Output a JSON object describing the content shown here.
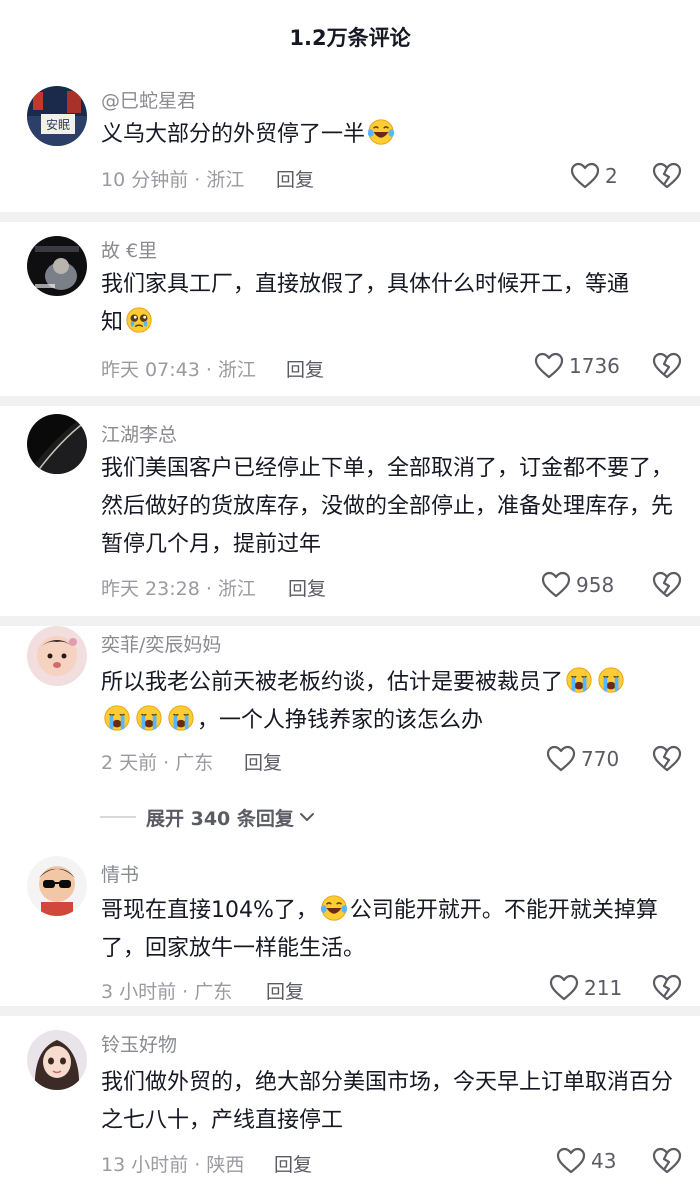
{
  "header": {
    "title": "1.2万条评论"
  },
  "comments": [
    {
      "author": "@巳蛇星君",
      "text": "义乌大部分的外贸停了一半",
      "time": "10 分钟前 · 浙江",
      "reply": "回复",
      "likes": "2",
      "avatar_text": "安眠"
    },
    {
      "author": "故 €里",
      "text_a": "我们家具工厂，直接放假了，具体什么时候开工，等通",
      "text_b": "知",
      "time": "昨天 07:43 · 浙江",
      "reply": "回复",
      "likes": "1736"
    },
    {
      "author": "江湖李总",
      "text": "我们美国客户已经停止下单，全部取消了，订金都不要了，然后做好的货放库存，没做的全部停止，准备处理库存，先暂停几个月，提前过年",
      "time": "昨天 23:28 · 浙江",
      "reply": "回复",
      "likes": "958"
    },
    {
      "author": "奕菲/奕辰妈妈",
      "text_a": "所以我老公前天被老板约谈，估计是要被裁员了",
      "text_b": "，一个人挣钱养家的该怎么办",
      "time": "2 天前 · 广东",
      "reply": "回复",
      "likes": "770"
    },
    {
      "author": "情书",
      "text_a": "哥现在直接104%了，",
      "text_b": "公司能开就开。不能开就关掉算了，回家放牛一样能生活。",
      "time": "3 小时前 · 广东",
      "reply": "回复",
      "likes": "211"
    },
    {
      "author": "铃玉好物",
      "text": "我们做外贸的，绝大部分美国市场，今天早上订单取消百分之七八十，产线直接停工",
      "time": "13 小时前 · 陕西",
      "reply": "回复",
      "likes": "43"
    }
  ],
  "expand_replies": {
    "label": "展开 340 条回复"
  },
  "icons": {
    "like": "heart-outline-icon",
    "dislike": "broken-heart-icon",
    "expand": "chevron-down-icon",
    "emoji_laugh": "laugh-cry-emoji",
    "emoji_pleading": "pleading-face-emoji",
    "emoji_sob": "loudly-crying-emoji"
  },
  "colors": {
    "text": "#161823",
    "meta": "#9a9ba1",
    "author": "#8a8b91",
    "action": "#5b5c63",
    "seam": "#f1f1f2"
  }
}
